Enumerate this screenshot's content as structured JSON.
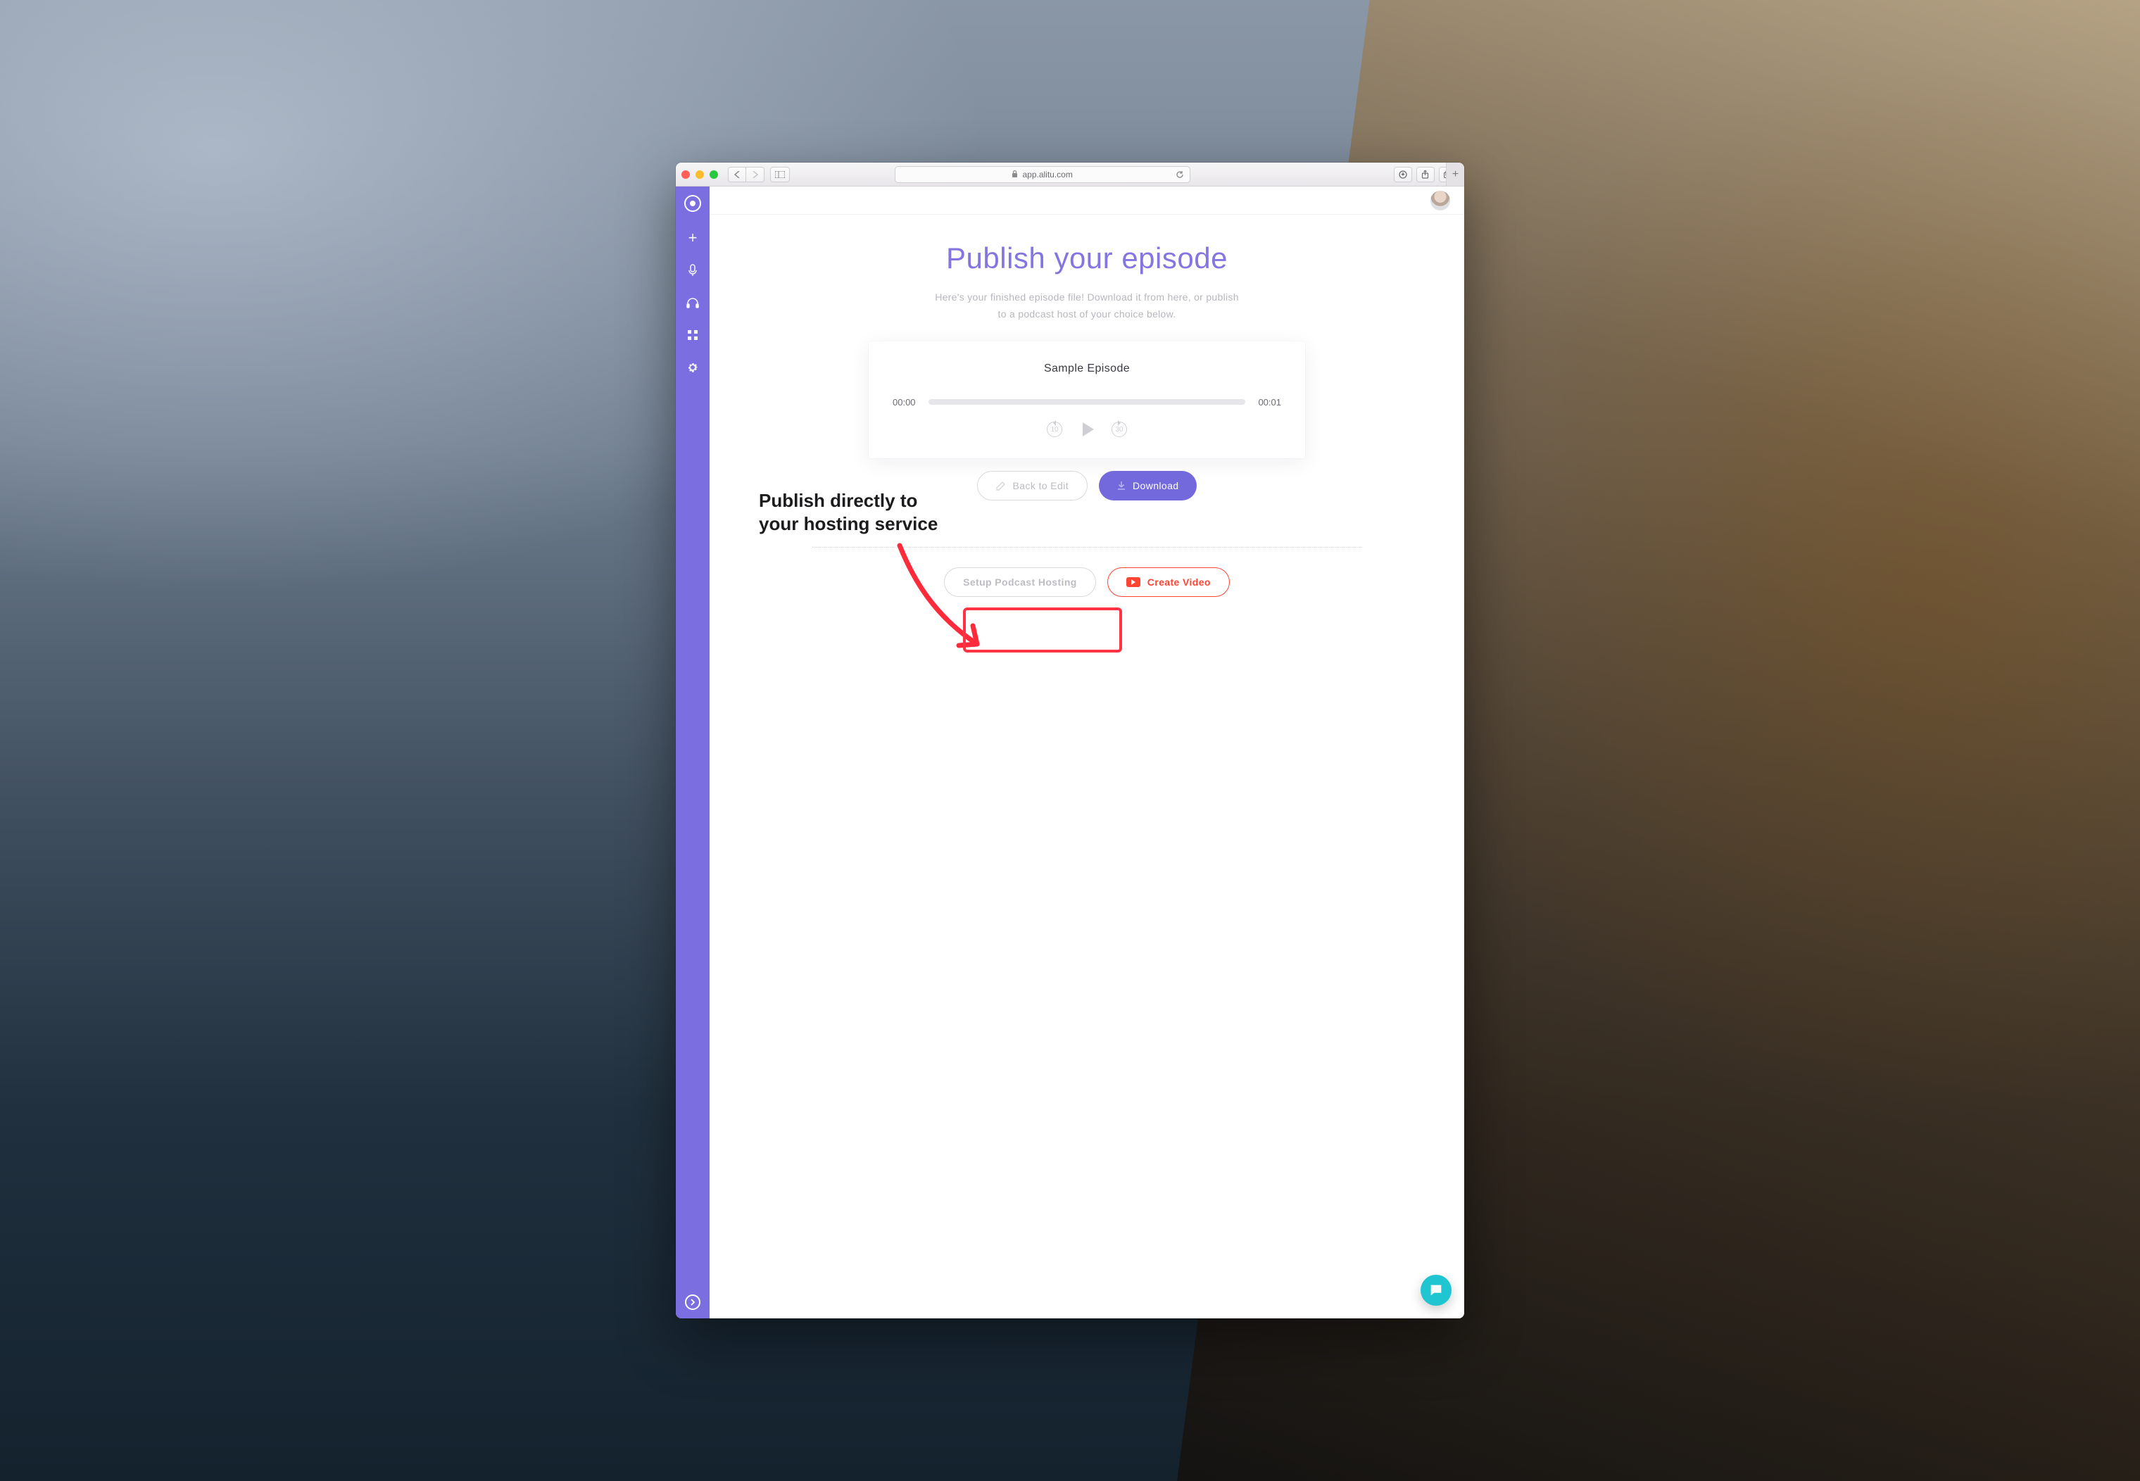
{
  "browser": {
    "url_host": "app.alitu.com",
    "lock_icon": "lock-icon"
  },
  "sidebar": {
    "items": [
      {
        "name": "logo"
      },
      {
        "name": "add"
      },
      {
        "name": "record"
      },
      {
        "name": "listen"
      },
      {
        "name": "library"
      },
      {
        "name": "settings"
      }
    ]
  },
  "page": {
    "title": "Publish your episode",
    "subtitle_line1": "Here's your finished episode file! Download it from here, or publish",
    "subtitle_line2": "to a podcast host of your choice below."
  },
  "episode": {
    "title": "Sample Episode",
    "current_time": "00:00",
    "duration": "00:01",
    "skip_back_seconds": "10",
    "skip_forward_seconds": "30"
  },
  "buttons": {
    "back_to_edit": "Back to Edit",
    "download": "Download",
    "setup_hosting": "Setup Podcast Hosting",
    "create_video": "Create Video"
  },
  "annotation": {
    "line1": "Publish directly to",
    "line2": "your hosting service"
  },
  "colors": {
    "accent": "#7a6ee0",
    "primary_button": "#7468dd",
    "danger": "#ff4433",
    "chat": "#1fc6d1"
  }
}
